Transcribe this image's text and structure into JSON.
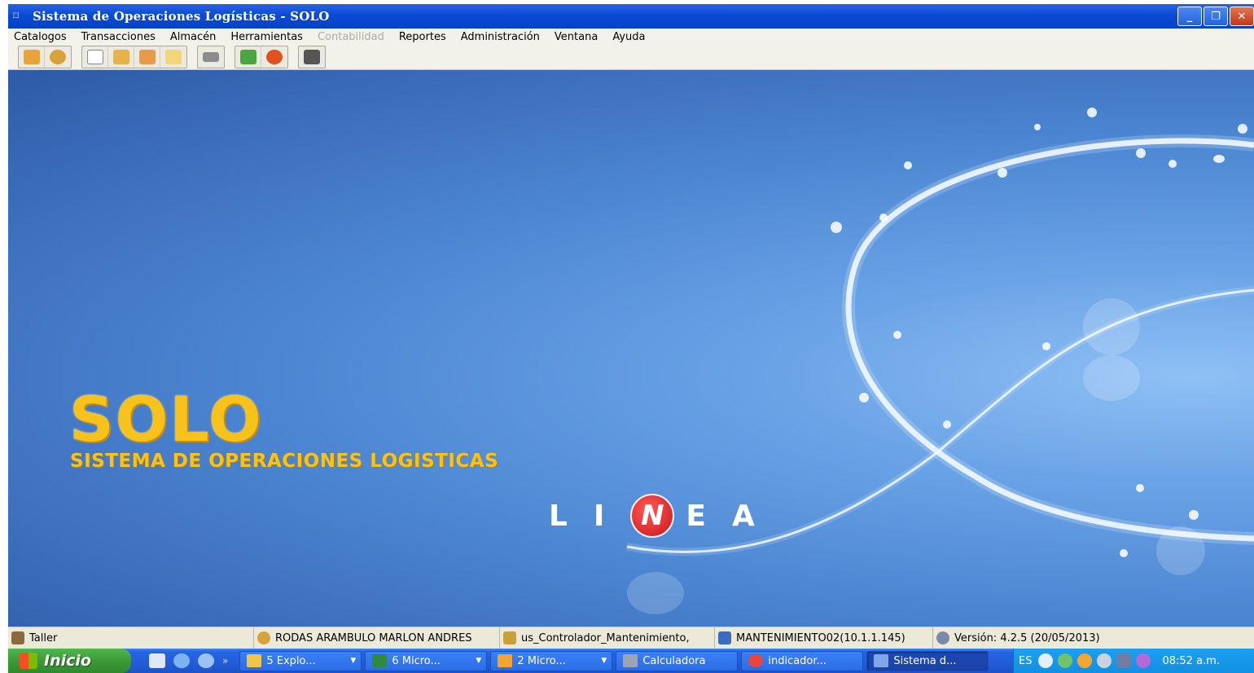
{
  "window": {
    "title": "Sistema de Operaciones Logísticas - SOLO",
    "controls": [
      "minimize",
      "restore",
      "close"
    ]
  },
  "menu": {
    "items": [
      {
        "label": "Catalogos",
        "enabled": true
      },
      {
        "label": "Transacciones",
        "enabled": true
      },
      {
        "label": "Almacén",
        "enabled": true
      },
      {
        "label": "Herramientas",
        "enabled": true
      },
      {
        "label": "Contabilidad",
        "enabled": false
      },
      {
        "label": "Reportes",
        "enabled": true
      },
      {
        "label": "Administración",
        "enabled": true
      },
      {
        "label": "Ventana",
        "enabled": true
      },
      {
        "label": "Ayuda",
        "enabled": true
      }
    ]
  },
  "toolbar": {
    "groups": [
      [
        {
          "icon": "box-icon",
          "color": "#e8a33a"
        },
        {
          "icon": "user-icon",
          "color": "#d9a13a"
        }
      ],
      [
        {
          "icon": "new-document-icon",
          "color": "#ffffff"
        },
        {
          "icon": "open-box-icon",
          "color": "#e8b24a"
        },
        {
          "icon": "box-search-icon",
          "color": "#e89a4a"
        },
        {
          "icon": "edit-document-icon",
          "color": "#f3d678"
        }
      ],
      [
        {
          "icon": "truck-icon",
          "color": "#8c8c8c"
        }
      ],
      [
        {
          "icon": "report-icon",
          "color": "#4aa63e"
        },
        {
          "icon": "refresh-icon",
          "color": "#e2501e"
        }
      ],
      [
        {
          "icon": "exit-icon",
          "color": "#555555"
        }
      ]
    ]
  },
  "splash": {
    "brand": "SOLO",
    "subtitle": "SISTEMA DE OPERACIONES LOGISTICAS",
    "company": {
      "l": "L",
      "i": "I",
      "n": "N",
      "e": "E",
      "a": "A"
    },
    "brand_color": "#f7c21b",
    "accent_color": "#d51820"
  },
  "statusbar": {
    "module": "Taller",
    "user": "RODAS ARAMBULO MARLON ANDRES",
    "controller": "us_Controlador_Mantenimiento,",
    "machine": "MANTENIMIENTO02(10.1.1.145)",
    "version": "Versión: 4.2.5 (20/05/2013)"
  },
  "taskbar": {
    "start_label": "Inicio",
    "quick_launch_more": "»",
    "tasks": [
      {
        "label": "5 Explo...",
        "icon": "folder-icon",
        "color": "#f1c44a",
        "grouped": true,
        "active": false
      },
      {
        "label": "6 Micro...",
        "icon": "excel-icon",
        "color": "#2e8b3d",
        "grouped": true,
        "active": false
      },
      {
        "label": "2 Micro...",
        "icon": "outlook-icon",
        "color": "#f3a533",
        "grouped": true,
        "active": false
      },
      {
        "label": "Calculadora",
        "icon": "calculator-icon",
        "color": "#9aa4b4",
        "grouped": false,
        "active": false
      },
      {
        "label": "indicador...",
        "icon": "chrome-icon",
        "color": "#e8463a",
        "grouped": false,
        "active": false
      },
      {
        "label": "Sistema d...",
        "icon": "app-icon",
        "color": "#7fa6e8",
        "grouped": false,
        "active": true
      }
    ],
    "tray": {
      "language": "ES",
      "clock": "08:52 a.m."
    }
  }
}
